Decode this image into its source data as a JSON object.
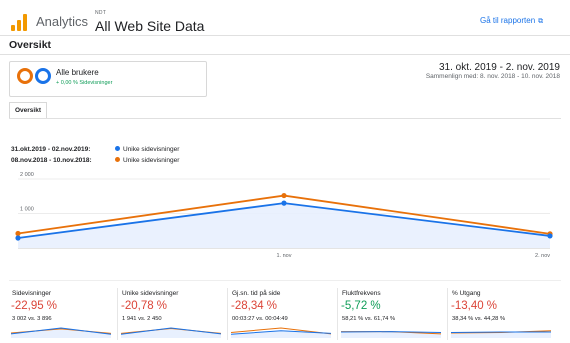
{
  "header": {
    "app_name": "Analytics",
    "account_label": "NDT",
    "view_name": "All Web Site Data",
    "report_link": "Gå til rapporten",
    "report_link_icon": "external-link-icon"
  },
  "section_title": "Oversikt",
  "segment": {
    "name": "Alle brukere",
    "subtitle": "+ 0,00 % Sidevisninger",
    "ring_colors": [
      "#e8710a",
      "#1a73e8"
    ]
  },
  "date": {
    "range": "31. okt. 2019 - 2. nov. 2019",
    "compare": "Sammenlign med: 8. nov. 2018 - 10. nov. 2018"
  },
  "tabs": [
    "Oversikt"
  ],
  "legend": [
    {
      "date_range": "31.okt.2019 - 02.nov.2019:",
      "metric": "Unike sidevisninger",
      "color": "#1a73e8"
    },
    {
      "date_range": "08.nov.2018 - 10.nov.2018:",
      "metric": "Unike sidevisninger",
      "color": "#e8710a"
    }
  ],
  "chart_data": {
    "type": "line",
    "x": [
      "",
      "1. nov",
      "2. nov"
    ],
    "y_ticks": [
      "2 000",
      "1 000"
    ],
    "ylim": [
      0,
      2000
    ],
    "series": [
      {
        "name": "31.okt.2019 - 02.nov.2019: Unike sidevisninger",
        "values": [
          290,
          1300,
          350
        ],
        "color": "#1a73e8",
        "fill": true
      },
      {
        "name": "08.nov.2018 - 10.nov.2018: Unike sidevisninger",
        "values": [
          420,
          1520,
          410
        ],
        "color": "#e8710a"
      }
    ]
  },
  "kpis": [
    {
      "label": "Sidevisninger",
      "value": "-22,95 %",
      "trend": "negative",
      "compare": "3 002 vs. 3 896",
      "spark": {
        "current": [
          0.35,
          1,
          0.3
        ],
        "previous": [
          0.45,
          0.9,
          0.4
        ]
      }
    },
    {
      "label": "Unike sidevisninger",
      "value": "-20,78 %",
      "trend": "negative",
      "compare": "1 941 vs. 2 450",
      "spark": {
        "current": [
          0.3,
          1,
          0.35
        ],
        "previous": [
          0.4,
          0.95,
          0.4
        ]
      }
    },
    {
      "label": "Gj.sn. tid på side",
      "value": "-28,34 %",
      "trend": "negative",
      "compare": "00:03:27 vs. 00:04:49",
      "spark": {
        "current": [
          0.3,
          0.7,
          0.4
        ],
        "previous": [
          0.5,
          1,
          0.35
        ]
      }
    },
    {
      "label": "Fluktfrekvens",
      "value": "-5,72 %",
      "trend": "positive",
      "compare": "58,21 % vs. 61,74 %",
      "spark": {
        "current": [
          0.55,
          0.6,
          0.5
        ],
        "previous": [
          0.6,
          0.6,
          0.35
        ]
      }
    },
    {
      "label": "% Utgang",
      "value": "-13,40 %",
      "trend": "negative",
      "compare": "38,34 % vs. 44,28 %",
      "spark": {
        "current": [
          0.5,
          0.55,
          0.55
        ],
        "previous": [
          0.45,
          0.5,
          0.7
        ]
      }
    }
  ]
}
